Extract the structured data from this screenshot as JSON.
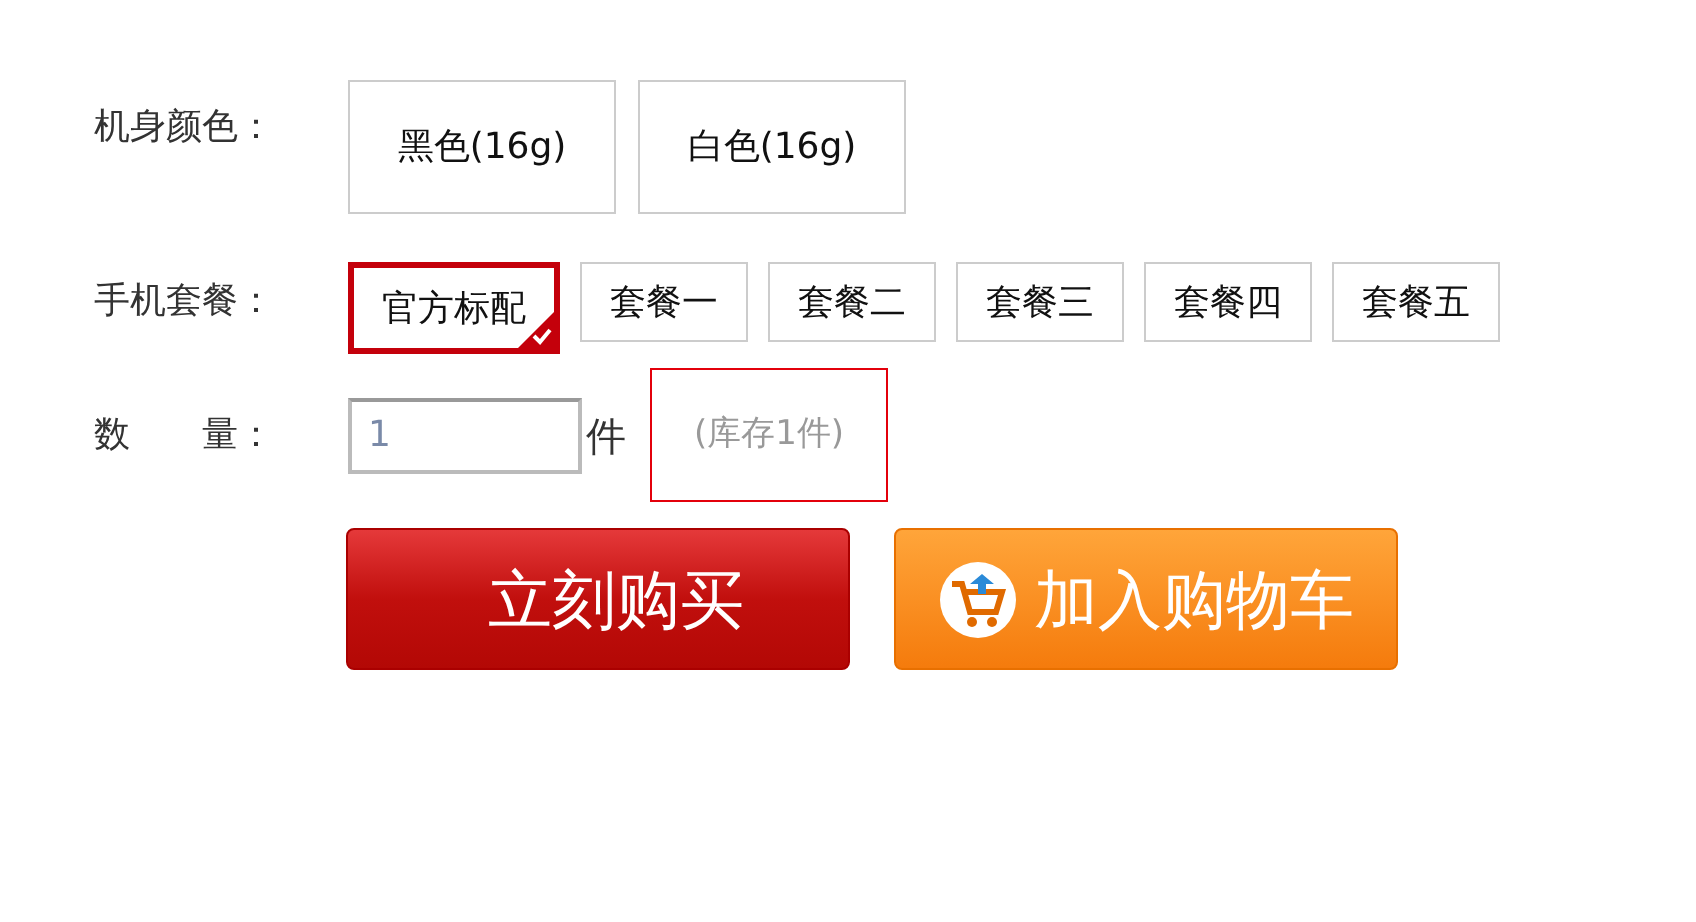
{
  "color_option": {
    "label": "机身颜色：",
    "options": [
      {
        "text": "黑色(16g)",
        "selected": false
      },
      {
        "text": "白色(16g)",
        "selected": false
      }
    ]
  },
  "package_option": {
    "label": "手机套餐：",
    "options": [
      {
        "text": "官方标配",
        "selected": true
      },
      {
        "text": "套餐一",
        "selected": false
      },
      {
        "text": "套餐二",
        "selected": false
      },
      {
        "text": "套餐三",
        "selected": false
      },
      {
        "text": "套餐四",
        "selected": false
      },
      {
        "text": "套餐五",
        "selected": false
      }
    ]
  },
  "quantity": {
    "label": "数　　量：",
    "value": "1",
    "unit": "件",
    "stock": "(库存1件)"
  },
  "buttons": [
    {
      "kind": "buy",
      "text": "立刻购买"
    },
    {
      "kind": "cart",
      "text": "加入购物车"
    }
  ]
}
